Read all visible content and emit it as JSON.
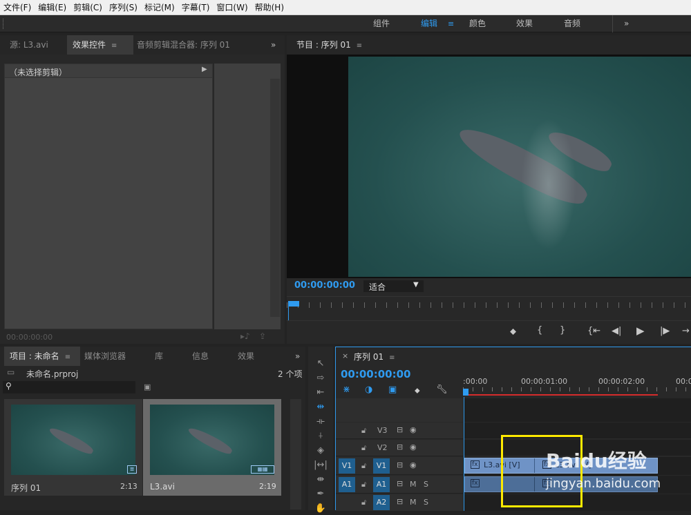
{
  "menu": [
    "文件(F)",
    "编辑(E)",
    "剪辑(C)",
    "序列(S)",
    "标记(M)",
    "字幕(T)",
    "窗口(W)",
    "帮助(H)"
  ],
  "workspaces": {
    "items": [
      "组件",
      "编辑",
      "颜色",
      "效果",
      "音频"
    ],
    "active": "编辑",
    "more": "»"
  },
  "source_panel": {
    "tabs": [
      "源: L3.avi",
      "效果控件",
      "音频剪辑混合器: 序列 01"
    ],
    "active_tab": "效果控件",
    "no_clip": "（未选择剪辑）",
    "timecode": "00:00:00:00",
    "more": "»"
  },
  "program_monitor": {
    "title": "节目 : 序列 01",
    "timecode": "00:00:00:00",
    "fit": "适合"
  },
  "project_panel": {
    "tabs": [
      "项目 : 未命名",
      "媒体浏览器",
      "库",
      "信息",
      "效果"
    ],
    "project_file": "未命名.prproj",
    "count": "2 个项",
    "items": [
      {
        "name": "序列 01",
        "duration": "2:13"
      },
      {
        "name": "L3.avi",
        "duration": "2:19"
      }
    ],
    "more": "»"
  },
  "timeline": {
    "tab": "序列 01",
    "timecode": "00:00:00:00",
    "ruler": [
      ":00:00",
      "00:00:01:00",
      "00:00:02:00",
      "00:00"
    ],
    "video_tracks": [
      "V3",
      "V2",
      "V1"
    ],
    "audio_tracks": [
      "A1",
      "A2"
    ],
    "source_patch_v": "V1",
    "source_patch_a": "A1",
    "mute": "M",
    "solo": "S",
    "clip_video": "L3.avi [V]",
    "clip_video_2": "L3.avi [V]"
  },
  "watermark": {
    "brand": "Baidu经验",
    "url": "jingyan.baidu.com"
  },
  "colors": {
    "accent": "#2f9bf0",
    "highlight_box": "#ffea00",
    "video_clip": "#6f93c6",
    "audio_clip": "#4d6e98",
    "playhead": "#2f9bf0",
    "ruler_red": "#d62b2b"
  }
}
